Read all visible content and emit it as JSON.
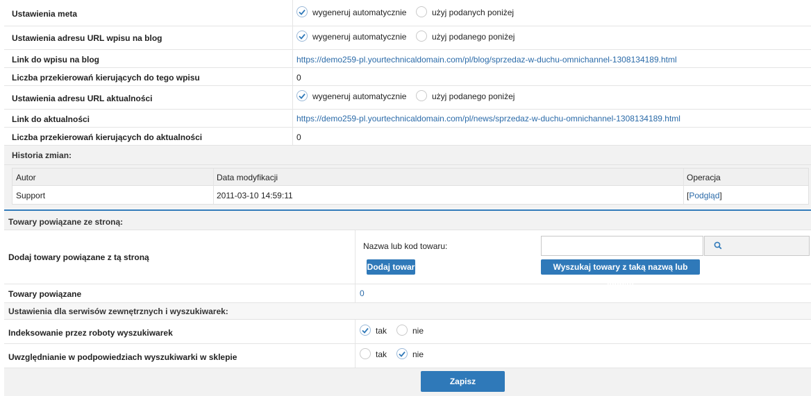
{
  "rows": {
    "meta": {
      "label": "Ustawienia meta",
      "opt1": "wygeneruj automatycznie",
      "opt2": "użyj podanych poniżej"
    },
    "blog_url": {
      "label": "Ustawienia adresu URL wpisu na blog",
      "opt1": "wygeneruj automatycznie",
      "opt2": "użyj podanego poniżej"
    },
    "blog_link": {
      "label": "Link do wpisu na blog",
      "value": "https://demo259-pl.yourtechnicaldomain.com/pl/blog/sprzedaz-w-duchu-omnichannel-1308134189.html"
    },
    "blog_redirects": {
      "label": "Liczba przekierowań kierujących do tego wpisu",
      "value": "0"
    },
    "news_url": {
      "label": "Ustawienia adresu URL aktualności",
      "opt1": "wygeneruj automatycznie",
      "opt2": "użyj podanego poniżej"
    },
    "news_link": {
      "label": "Link do aktualności",
      "value": "https://demo259-pl.yourtechnicaldomain.com/pl/news/sprzedaz-w-duchu-omnichannel-1308134189.html"
    },
    "news_redirects": {
      "label": "Liczba przekierowań kierujących do aktualności",
      "value": "0"
    }
  },
  "history": {
    "title": "Historia zmian:",
    "columns": [
      "Autor",
      "Data modyfikacji",
      "Operacja"
    ],
    "row": {
      "author": "Support",
      "date": "2011-03-10 14:59:11",
      "op_open": "[",
      "op_link": "Podgląd",
      "op_close": "]"
    }
  },
  "related": {
    "section_title": "Towary powiązane ze stroną:",
    "add_label": "Dodaj towary powiązane z tą stroną",
    "name_label": "Nazwa lub kod towaru:",
    "input_value": "",
    "add_button": "Dodaj towar",
    "search_button": "Wyszukaj towary z taką nazwą lub kodem",
    "count_label": "Towary powiązane",
    "count_value": "0"
  },
  "external": {
    "section_title": "Ustawienia dla serwisów zewnętrznych i wyszukiwarek:",
    "indexing_label": "Indeksowanie przez roboty wyszukiwarek",
    "suggest_label": "Uwzględnianie w podpowiedziach wyszukiwarki w sklepie",
    "yes": "tak",
    "no": "nie"
  },
  "save_button": "Zapisz",
  "colors": {
    "accent": "#2f79b9",
    "link": "#2a6aa8",
    "section_bg": "#f2f2f2"
  }
}
